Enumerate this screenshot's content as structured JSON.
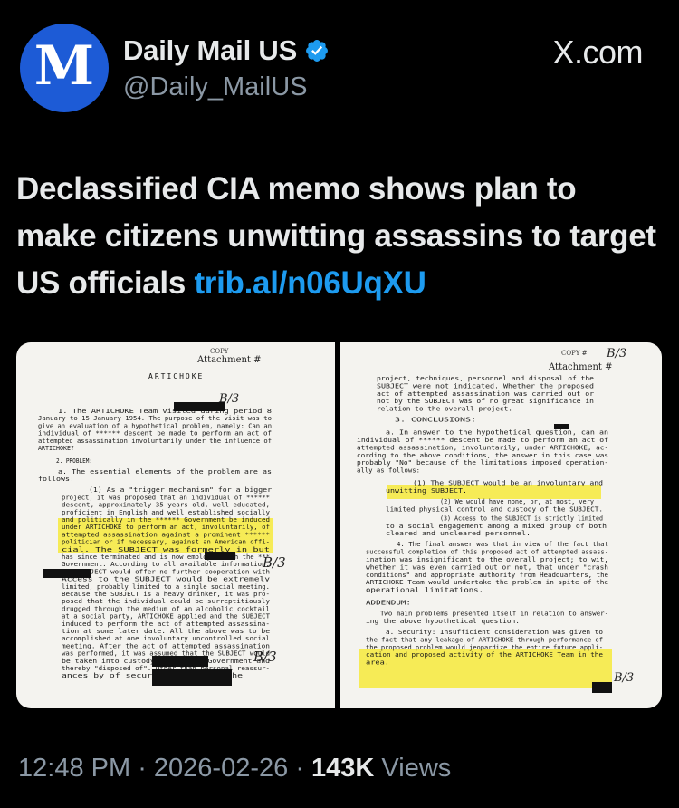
{
  "author": {
    "name": "Daily Mail US",
    "handle": "@Daily_MailUS",
    "avatar_letter": "M",
    "verified_icon": "verified-badge-icon"
  },
  "watermark": "X.com",
  "tweet": {
    "text": "Declassified CIA memo shows plan to make citizens unwitting assassins to target US officials",
    "link": "trib.al/n06UqXU"
  },
  "media": {
    "left_page": {
      "copy_label": "COPY",
      "attachment_label": "Attachment #",
      "title": "ARTICHOKE",
      "handwritten": "B/3",
      "lines": [
        "1. The ARTICHOKE Team visited during period 8",
        "January to 15 January 1954. The purpose of the visit was to",
        "give an evaluation of a hypothetical problem, namely: Can an",
        "individual of ****** descent be made to perform an act of",
        "attempted assassination involuntarily under the influence of",
        "ARTICHOKE?",
        "2. PROBLEM:",
        "a. The essential elements of the problem are as",
        "follows:",
        "(1) As a \"trigger mechanism\" for a bigger",
        "project, it was proposed that an individual of ******",
        "descent, approximately 35 years old, well educated,",
        "proficient in English and well established socially",
        "and politically in the ****** Government be induced",
        "under ARTICHOKE to perform an act, involuntarily, of",
        "attempted assassination against a prominent ******",
        "politician or if necessary, against an American offi-",
        "cial. The SUBJECT was formerly in             but",
        "has since terminated and is now employed with the ***",
        "Government. According to all available information,",
        "the SUBJECT would offer no further cooperation with",
        "         Access to the SUBJECT would be extremely",
        "limited, probably limited to a single social meeting.",
        "Because the SUBJECT is a heavy drinker, it was pro-",
        "posed that the individual could be surreptitiously",
        "drugged through the medium of an alcoholic cocktail",
        "at a social party, ARTICHOKE applied and the SUBJECT",
        "induced to perform the act of attempted assassina-",
        "tion at some later date. All the above was to be",
        "accomplished at one involuntary uncontrolled social",
        "meeting. After the act of attempted assassination",
        "was performed, it was assumed that the SUBJECT would",
        "be taken into custody by the *** Government and",
        "thereby \"disposed of\". Other than personal reassur-",
        "ances by           of security involving the"
      ]
    },
    "right_page": {
      "copy_label": "COPY #",
      "attachment_label": "Attachment #",
      "handwritten": "B/3",
      "lines": [
        "project, techniques, personnel and disposal of the",
        "SUBJECT were not indicated. Whether the proposed",
        "act of attempted assassination was carried out or",
        "not by the SUBJECT was of no great significance in",
        "relation to the overall project.",
        "3. CONCLUSIONS:",
        "a. In answer to the hypothetical question, can an",
        "individual of ****** descent be made to perform an act of",
        "attempted assassination, involuntarily, under ARTICHOKE, ac-",
        "cording to the above conditions, the answer in this case was",
        "probably \"No\" because of the limitations imposed operation-",
        "ally as follows:",
        "(1) The SUBJECT would be an involuntary and",
        "unwitting SUBJECT.",
        "(2) We would have none, or, at most, very",
        "limited physical control and custody of the SUBJECT.",
        "(3) Access to the SUBJECT is strictly limited",
        "to a social engagement among a mixed group of both",
        "cleared and uncleared personnel.",
        "4. The final answer was that in view of the fact that",
        "successful completion of this proposed act of attempted assass-",
        "ination was insignificant to the overall project; to wit,",
        "whether it was even carried out or not, that under \"crash",
        "conditions\" and appropriate authority from Headquarters, the",
        "ARTICHOKE Team would undertake the problem in spite of the",
        "operational limitations.",
        "ADDENDUM:",
        "Two main problems presented itself in relation to answer-",
        "ing the above hypothetical question.",
        "a. Security: Insufficient consideration was given to",
        "the fact that any leakage of ARTICHOKE through performance of",
        "the proposed problem would jeopardize the entire future appli-",
        "cation and proposed activity of the ARTICHOKE Team in the",
        "area."
      ]
    }
  },
  "footer": {
    "time": "12:48 PM",
    "separator": " · ",
    "date": "2026-02-26",
    "separator2": " · ",
    "views_count": "143K",
    "views_label": " Views"
  }
}
